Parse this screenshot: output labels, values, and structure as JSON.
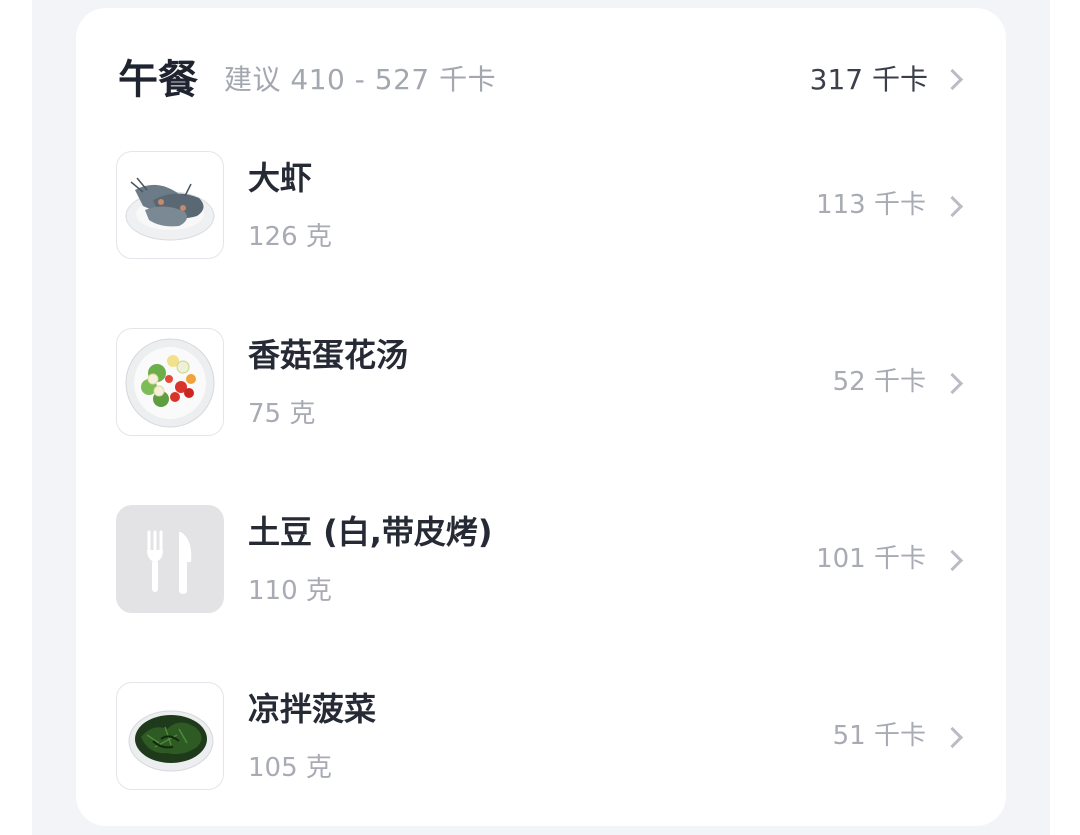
{
  "meal": {
    "title": "午餐",
    "suggestion": "建议 410 - 527 千卡",
    "total_kcal": "317 千卡"
  },
  "foods": [
    {
      "name": "大虾",
      "weight": "126 克",
      "kcal": "113 千卡",
      "icon": "shrimp-plate-icon"
    },
    {
      "name": "香菇蛋花汤",
      "weight": "75 克",
      "kcal": "52 千卡",
      "icon": "salad-plate-icon"
    },
    {
      "name": "土豆 (白,带皮烤)",
      "weight": "110 克",
      "kcal": "101 千卡",
      "icon": "fork-knife-icon"
    },
    {
      "name": "凉拌菠菜",
      "weight": "105 克",
      "kcal": "51 千卡",
      "icon": "spinach-plate-icon"
    }
  ],
  "colors": {
    "page_background": "#f3f4f8",
    "card_background": "#ffffff",
    "title_text": "#1f2430",
    "secondary_text": "#a8abb3"
  }
}
